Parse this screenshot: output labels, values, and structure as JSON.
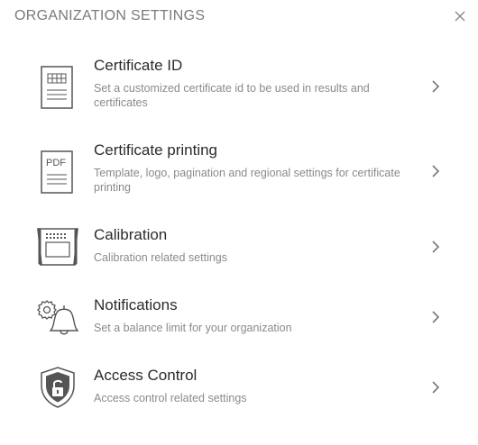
{
  "header": {
    "title": "ORGANIZATION SETTINGS",
    "close_icon": "close-icon"
  },
  "items": [
    {
      "title": "Certificate ID",
      "description": "Set a customized certificate id to be used in results and certificates",
      "icon": "certificate-id-icon"
    },
    {
      "title": "Certificate printing",
      "description": "Template, logo, pagination and regional settings for certificate printing",
      "icon": "pdf-document-icon",
      "icon_text": "PDF"
    },
    {
      "title": "Calibration",
      "description": "Calibration related settings",
      "icon": "calibration-device-icon"
    },
    {
      "title": "Notifications",
      "description": "Set a balance limit for your organization",
      "icon": "bell-gear-icon"
    },
    {
      "title": "Access Control",
      "description": "Access control related settings",
      "icon": "shield-lock-icon"
    }
  ],
  "colors": {
    "icon_stroke": "#555555",
    "title_text": "#2b2b2b",
    "description_text": "#8a8a8a",
    "header_text": "#7a7a7a",
    "chevron": "#777777"
  }
}
